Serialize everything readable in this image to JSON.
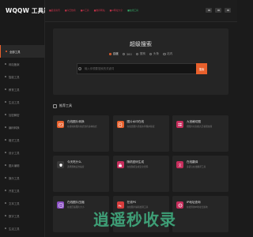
{
  "app": {
    "logo": "WQQW 工具箱"
  },
  "sidebar": {
    "items": [
      {
        "label": "全部工具",
        "active": true
      },
      {
        "label": "网站备案"
      },
      {
        "label": "智能工具"
      },
      {
        "label": "教育工具"
      },
      {
        "label": "生活工具"
      },
      {
        "label": "加密解密"
      },
      {
        "label": "编码转换"
      },
      {
        "label": "格式工具"
      },
      {
        "label": "设计工具"
      },
      {
        "label": "图片编辑"
      },
      {
        "label": "娱乐工具"
      },
      {
        "label": "开发工具"
      },
      {
        "label": "文本工具"
      },
      {
        "label": "数字工具"
      },
      {
        "label": "生活工具"
      }
    ]
  },
  "topbar": {
    "links": [
      {
        "label": "■最新资讯",
        "color": "red"
      },
      {
        "label": "■今日热榜",
        "color": "red"
      },
      {
        "label": "■AI工具",
        "color": "red"
      },
      {
        "label": "■推荐网站",
        "color": "red"
      },
      {
        "label": "■AI网址大全",
        "color": "red"
      },
      {
        "label": "■在线工具",
        "color": "green"
      }
    ],
    "icons": [
      "theme-icon",
      "message-icon",
      "user-icon"
    ]
  },
  "search": {
    "title": "超级搜索",
    "engines": [
      {
        "label": "百度",
        "selected": true
      },
      {
        "label": "360"
      },
      {
        "label": "搜狗"
      },
      {
        "label": "头条"
      },
      {
        "label": "站内"
      }
    ],
    "placeholder": "输入你想要搜索的关键词",
    "button_label": "搜索"
  },
  "section": {
    "title": "推荐工具"
  },
  "tools": [
    {
      "name": "在线图片转换",
      "desc": "在线转换图片格式支持多种格式",
      "color": "#e8602c",
      "icon": "image-icon"
    },
    {
      "name": "图片水印在线",
      "desc": "在线给图片添加水印保护版权",
      "color": "#e8602c",
      "icon": "stamp-icon"
    },
    {
      "name": "九宫格切图",
      "desc": "把图片切割成九宫格朋友圈",
      "color": "#c62d5c",
      "icon": "grid-icon"
    },
    {
      "name": "今天吃什么",
      "desc": "选择困难症的福音",
      "color": "#3a3a3a",
      "icon": "chef-icon"
    },
    {
      "name": "随机密码生成",
      "desc": "在线随机生成安全密码",
      "color": "#c62d5c",
      "icon": "lock-icon"
    },
    {
      "name": "在线翻译",
      "desc": "多语言在线翻译工具",
      "color": "#c62d5c",
      "icon": "translate-icon"
    },
    {
      "name": "在线图片压缩",
      "desc": "在线压缩图片大小",
      "color": "#8a4ec2",
      "icon": "compress-icon"
    },
    {
      "name": "在线PS",
      "desc": "在线图片编辑处理工具",
      "color": "#d83c3c",
      "icon": "ps-icon"
    },
    {
      "name": "IP地址查询",
      "desc": "在线查询IP地址归属地",
      "color": "#c62d5c",
      "icon": "ip-icon"
    }
  ],
  "watermark": "逍遥秒收录"
}
